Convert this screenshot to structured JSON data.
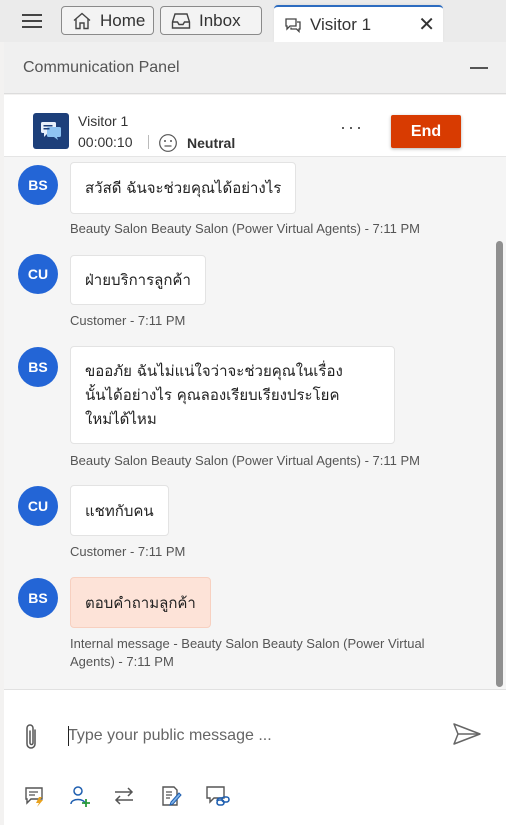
{
  "tabs": {
    "home": "Home",
    "inbox": "Inbox",
    "visitor": "Visitor 1"
  },
  "panel": {
    "title": "Communication Panel"
  },
  "session": {
    "visitor_name": "Visitor 1",
    "timer": "00:00:10",
    "sentiment": "Neutral",
    "more": "···",
    "end_label": "End"
  },
  "messages": [
    {
      "initials": "BS",
      "text": "สวัสดี ฉันจะช่วยคุณได้อย่างไร",
      "meta": "Beauty Salon Beauty Salon (Power Virtual Agents) - 7:11 PM"
    },
    {
      "initials": "CU",
      "text": "ฝ่ายบริการลูกค้า",
      "meta": "Customer - 7:11 PM"
    },
    {
      "initials": "BS",
      "lines": [
        "ขออภัย ฉันไม่แน่ใจว่าจะช่วยคุณในเรื่อง",
        "นั้นได้อย่างไร คุณลองเรียบเรียงประโยค",
        "ใหม่ได้ไหม"
      ],
      "meta": "Beauty Salon Beauty Salon (Power Virtual Agents) - 7:11 PM"
    },
    {
      "initials": "CU",
      "text": "แชทกับคน",
      "meta": "Customer - 7:11 PM"
    },
    {
      "initials": "BS",
      "text": "ตอบคำถามลูกค้า",
      "meta_lines": [
        "Internal message - Beauty Salon Beauty Salon (Power Virtual",
        "Agents) - 7:11 PM"
      ]
    }
  ],
  "composer": {
    "placeholder": "Type your public message ..."
  },
  "colors": {
    "accent": "#2d6cc0",
    "avatar": "#2365d6",
    "end_button": "#d83b01",
    "internal_bubble": "#fde3d8"
  },
  "icons": {
    "menu": "hamburger-icon",
    "home": "home-icon",
    "inbox": "inbox-icon",
    "visitor_tab": "chat-icon",
    "close": "close-icon",
    "minimize": "minimize-icon",
    "chat": "chat-bubbles-icon",
    "sentiment": "neutral-face-icon",
    "attach": "paperclip-icon",
    "send": "send-icon",
    "quick_replies": "quick-replies-icon",
    "consult": "consult-icon",
    "transfer": "transfer-icon",
    "notes": "notes-icon",
    "link": "link-record-icon"
  }
}
